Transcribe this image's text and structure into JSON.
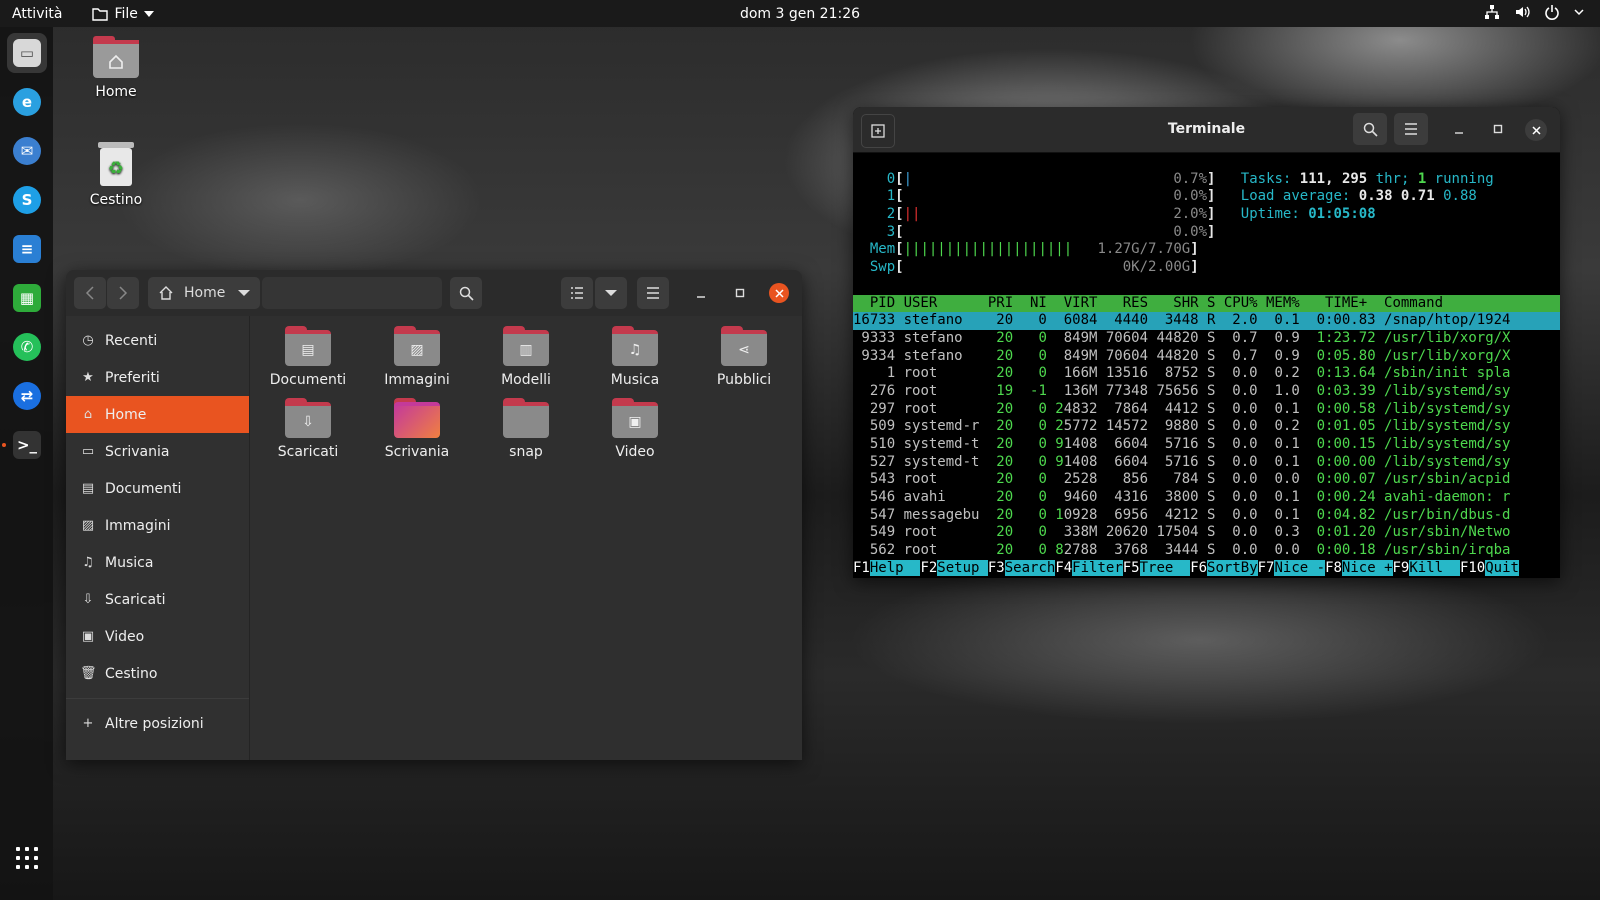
{
  "topbar": {
    "activities": "Attività",
    "app_menu": "File",
    "clock": "dom 3 gen  21:26"
  },
  "desktop": {
    "icons": [
      {
        "label": "Home"
      },
      {
        "label": "Cestino"
      }
    ]
  },
  "files": {
    "location": "Home",
    "sidebar": [
      {
        "label": "Recenti",
        "icon": "clock-icon"
      },
      {
        "label": "Preferiti",
        "icon": "star-icon"
      },
      {
        "label": "Home",
        "icon": "home-icon",
        "active": true
      },
      {
        "label": "Scrivania",
        "icon": "desktop-icon"
      },
      {
        "label": "Documenti",
        "icon": "document-icon"
      },
      {
        "label": "Immagini",
        "icon": "image-icon"
      },
      {
        "label": "Musica",
        "icon": "music-icon"
      },
      {
        "label": "Scaricati",
        "icon": "download-icon"
      },
      {
        "label": "Video",
        "icon": "video-icon"
      },
      {
        "label": "Cestino",
        "icon": "trash-icon"
      }
    ],
    "other_locations": "Altre posizioni",
    "folders": [
      {
        "label": "Documenti",
        "icon": "document-icon"
      },
      {
        "label": "Immagini",
        "icon": "image-icon"
      },
      {
        "label": "Modelli",
        "icon": "template-icon"
      },
      {
        "label": "Musica",
        "icon": "music-icon"
      },
      {
        "label": "Pubblici",
        "icon": "share-icon"
      },
      {
        "label": "Scaricati",
        "icon": "download-icon"
      },
      {
        "label": "Scrivania",
        "icon": "desktop-icon"
      },
      {
        "label": "snap",
        "icon": "folder-icon"
      },
      {
        "label": "Video",
        "icon": "video-icon"
      }
    ]
  },
  "terminal": {
    "title": "Terminale",
    "meters": [
      {
        "label": "0",
        "bar": "|",
        "value": "0.7%"
      },
      {
        "label": "1",
        "bar": "",
        "value": "0.0%"
      },
      {
        "label": "2",
        "bar": "||",
        "value": "2.0%"
      },
      {
        "label": "3",
        "bar": "",
        "value": "0.0%"
      },
      {
        "label": "Mem",
        "bar": "||||||||||||||||||||",
        "value": "1.27G/7.70G"
      },
      {
        "label": "Swp",
        "bar": "",
        "value": "0K/2.00G"
      }
    ],
    "tasks": {
      "label": "Tasks:",
      "tasks": "111,",
      "thr": "295",
      "thr_label": "thr;",
      "running": "1",
      "running_label": "running"
    },
    "load": {
      "label": "Load average:",
      "v1": "0.38",
      "v5": "0.71",
      "v15": "0.88"
    },
    "uptime": {
      "label": "Uptime:",
      "value": "01:05:08"
    },
    "header": "  PID USER      PRI  NI  VIRT   RES   SHR S CPU% MEM%   TIME+  Command",
    "rows": [
      "16733 stefano    20   0  6084  4440  3448 R  2.0  0.1  0:00.83 /snap/htop/1924",
      " 9333 stefano    20   0  849M 70604 44820 S  0.7  0.9  1:23.72 /usr/lib/xorg/X",
      " 9334 stefano    20   0  849M 70604 44820 S  0.7  0.9  0:05.80 /usr/lib/xorg/X",
      "    1 root       20   0  166M 13516  8752 S  0.0  0.2  0:13.64 /sbin/init spla",
      "  276 root       19  -1  136M 77348 75656 S  0.0  1.0  0:03.39 /lib/systemd/sy",
      "  297 root       20   0 24832  7864  4412 S  0.0  0.1  0:00.58 /lib/systemd/sy",
      "  509 systemd-r  20   0 25772 14572  9880 S  0.0  0.2  0:01.05 /lib/systemd/sy",
      "  510 systemd-t  20   0 91408  6604  5716 S  0.0  0.1  0:00.15 /lib/systemd/sy",
      "  527 systemd-t  20   0 91408  6604  5716 S  0.0  0.1  0:00.00 /lib/systemd/sy",
      "  543 root       20   0  2528   856   784 S  0.0  0.0  0:00.07 /usr/sbin/acpid",
      "  546 avahi      20   0  9460  4316  3800 S  0.0  0.1  0:00.24 avahi-daemon: r",
      "  547 messagebu  20   0 10928  6956  4212 S  0.0  0.1  0:04.82 /usr/bin/dbus-d",
      "  549 root       20   0  338M 20620 17504 S  0.0  0.3  0:01.20 /usr/sbin/Netwo",
      "  562 root       20   0 82788  3768  3444 S  0.0  0.0  0:00.18 /usr/sbin/irqba"
    ],
    "fkeys": [
      {
        "k": "F1",
        "v": "Help  "
      },
      {
        "k": "F2",
        "v": "Setup "
      },
      {
        "k": "F3",
        "v": "Search"
      },
      {
        "k": "F4",
        "v": "Filter"
      },
      {
        "k": "F5",
        "v": "Tree  "
      },
      {
        "k": "F6",
        "v": "SortBy"
      },
      {
        "k": "F7",
        "v": "Nice -"
      },
      {
        "k": "F8",
        "v": "Nice +"
      },
      {
        "k": "F9",
        "v": "Kill  "
      },
      {
        "k": "F10",
        "v": "Quit"
      }
    ]
  },
  "dock": [
    {
      "name": "files-app-icon",
      "color": "#d8d8d8",
      "active": true
    },
    {
      "name": "edge-dev-browser-icon",
      "color": "#2aa0e0"
    },
    {
      "name": "thunderbird-icon",
      "color": "#3b7fd0"
    },
    {
      "name": "skype-icon",
      "color": "#1e9fe6"
    },
    {
      "name": "libreoffice-writer-icon",
      "color": "#2a7fd4"
    },
    {
      "name": "libreoffice-calc-icon",
      "color": "#2eab3a"
    },
    {
      "name": "whatsapp-icon",
      "color": "#25c05a"
    },
    {
      "name": "teamviewer-icon",
      "color": "#1a6fe0"
    },
    {
      "name": "terminal-app-icon",
      "color": "#333333"
    }
  ]
}
